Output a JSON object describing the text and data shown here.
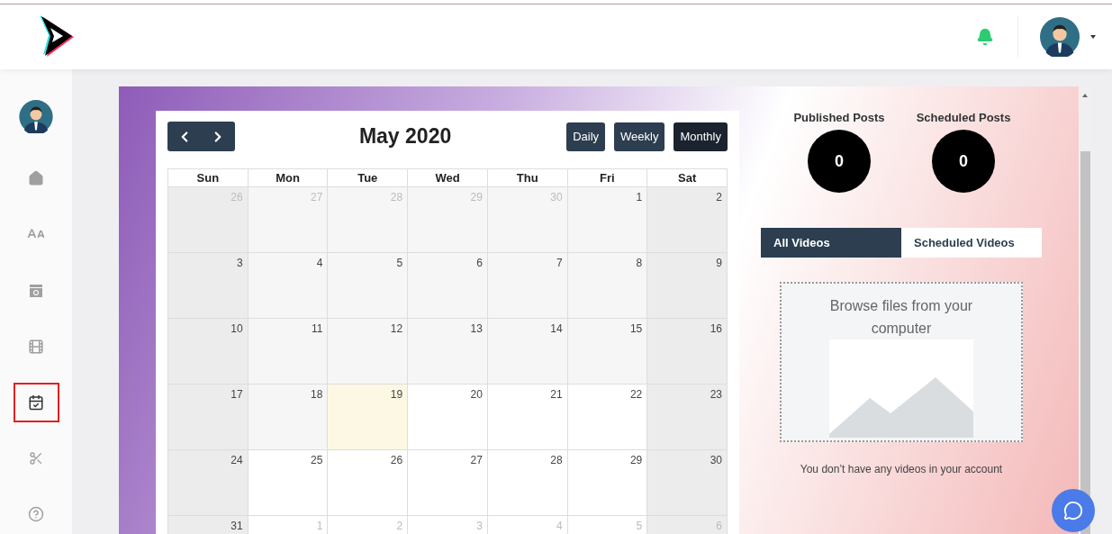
{
  "sidebar": {
    "items": [
      {
        "selected": false
      },
      {
        "selected": false
      },
      {
        "selected": false
      },
      {
        "selected": false
      },
      {
        "selected": true
      },
      {
        "selected": false
      },
      {
        "selected": false
      }
    ]
  },
  "calendar": {
    "title": "May 2020",
    "views": [
      {
        "label": "Daily",
        "selected": false
      },
      {
        "label": "Weekly",
        "selected": false
      },
      {
        "label": "Monthly",
        "selected": true
      }
    ],
    "weekdays": [
      "Sun",
      "Mon",
      "Tue",
      "Wed",
      "Thu",
      "Fri",
      "Sat"
    ],
    "weeks": [
      [
        {
          "day": "26",
          "outside": true,
          "kind": "weekend"
        },
        {
          "day": "27",
          "outside": true,
          "kind": "past"
        },
        {
          "day": "28",
          "outside": true,
          "kind": "past"
        },
        {
          "day": "29",
          "outside": true,
          "kind": "past"
        },
        {
          "day": "30",
          "outside": true,
          "kind": "past"
        },
        {
          "day": "1",
          "outside": false,
          "kind": "past"
        },
        {
          "day": "2",
          "outside": false,
          "kind": "weekend"
        }
      ],
      [
        {
          "day": "3",
          "outside": false,
          "kind": "weekend"
        },
        {
          "day": "4",
          "outside": false,
          "kind": "past"
        },
        {
          "day": "5",
          "outside": false,
          "kind": "past"
        },
        {
          "day": "6",
          "outside": false,
          "kind": "past"
        },
        {
          "day": "7",
          "outside": false,
          "kind": "past"
        },
        {
          "day": "8",
          "outside": false,
          "kind": "past"
        },
        {
          "day": "9",
          "outside": false,
          "kind": "weekend"
        }
      ],
      [
        {
          "day": "10",
          "outside": false,
          "kind": "weekend"
        },
        {
          "day": "11",
          "outside": false,
          "kind": "past"
        },
        {
          "day": "12",
          "outside": false,
          "kind": "past"
        },
        {
          "day": "13",
          "outside": false,
          "kind": "past"
        },
        {
          "day": "14",
          "outside": false,
          "kind": "past"
        },
        {
          "day": "15",
          "outside": false,
          "kind": "past"
        },
        {
          "day": "16",
          "outside": false,
          "kind": "weekend"
        }
      ],
      [
        {
          "day": "17",
          "outside": false,
          "kind": "weekend"
        },
        {
          "day": "18",
          "outside": false,
          "kind": "past"
        },
        {
          "day": "19",
          "outside": false,
          "kind": "today"
        },
        {
          "day": "20",
          "outside": false,
          "kind": "open"
        },
        {
          "day": "21",
          "outside": false,
          "kind": "open"
        },
        {
          "day": "22",
          "outside": false,
          "kind": "open"
        },
        {
          "day": "23",
          "outside": false,
          "kind": "weekend"
        }
      ],
      [
        {
          "day": "24",
          "outside": false,
          "kind": "weekend"
        },
        {
          "day": "25",
          "outside": false,
          "kind": "open"
        },
        {
          "day": "26",
          "outside": false,
          "kind": "open"
        },
        {
          "day": "27",
          "outside": false,
          "kind": "open"
        },
        {
          "day": "28",
          "outside": false,
          "kind": "open"
        },
        {
          "day": "29",
          "outside": false,
          "kind": "open"
        },
        {
          "day": "30",
          "outside": false,
          "kind": "weekend"
        }
      ],
      [
        {
          "day": "31",
          "outside": false,
          "kind": "weekend"
        },
        {
          "day": "1",
          "outside": true,
          "kind": "open"
        },
        {
          "day": "2",
          "outside": true,
          "kind": "open"
        },
        {
          "day": "3",
          "outside": true,
          "kind": "open"
        },
        {
          "day": "4",
          "outside": true,
          "kind": "open"
        },
        {
          "day": "5",
          "outside": true,
          "kind": "open"
        },
        {
          "day": "6",
          "outside": true,
          "kind": "weekend"
        }
      ]
    ]
  },
  "stats": [
    {
      "label": "Published Posts",
      "value": "0"
    },
    {
      "label": "Scheduled Posts",
      "value": "0"
    }
  ],
  "video_tabs": [
    {
      "label": "All Videos",
      "selected": true
    },
    {
      "label": "Scheduled Videos",
      "selected": false
    }
  ],
  "upload": {
    "prompt": "Browse files from your computer"
  },
  "empty_message": "You don’t have any videos in your account"
}
